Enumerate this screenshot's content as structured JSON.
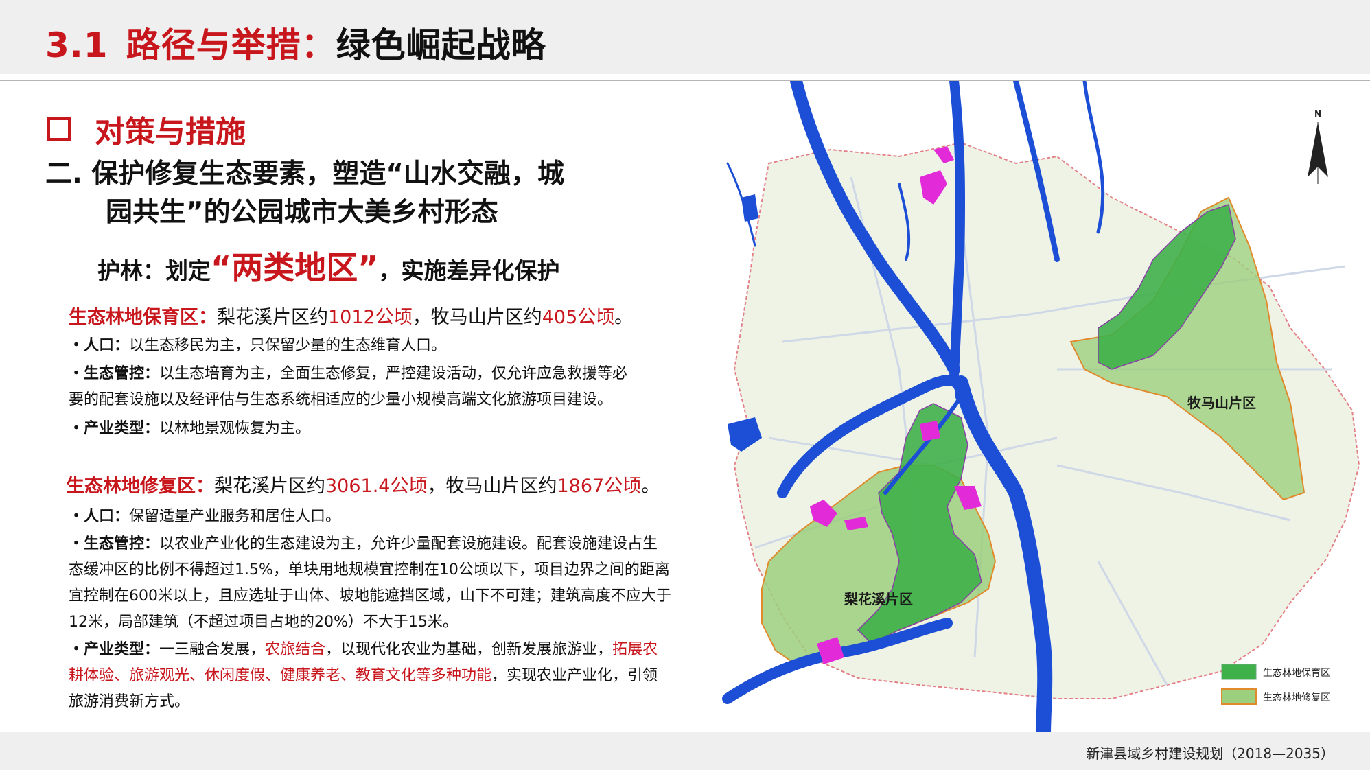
{
  "header": {
    "number": "3.1",
    "title_red": "路径与举措：",
    "title_black": "绿色崛起战略"
  },
  "section": {
    "heading": "对策与措施",
    "subheading_line1": "二.  保护修复生态要素，塑造“山水交融，城",
    "subheading_line2": "园共生”的公园城市大美乡村形态",
    "tagline_pre": "护林：划定",
    "tagline_highlight": "“两类地区”",
    "tagline_post": "，实施差异化保护"
  },
  "zone1": {
    "title": "生态林地保育区：",
    "t1": "梨花溪片区约",
    "v1": "1012公顷",
    "t2": "，牧马山片区约",
    "v2": "405公顷",
    "t3": "。",
    "pop_label": "・人口：",
    "pop_text": "以生态移民为主，只保留少量的生态维育人口。",
    "eco_label": "・生态管控：",
    "eco_text1": "以生态培育为主，全面生态修复，严控建设活动，仅允许应急救援等必",
    "eco_text2": "要的配套设施以及经评估与生态系统相适应的少量小规模高端文化旅游项目建设。",
    "ind_label": "・产业类型：",
    "ind_text": "以林地景观恢复为主。"
  },
  "zone2": {
    "title": "生态林地修复区：",
    "t1": "梨花溪片区约",
    "v1": "3061.4公顷",
    "t2": "，牧马山片区约",
    "v2": "1867公顷",
    "t3": "。",
    "pop_label": "・人口：",
    "pop_text": "保留适量产业服务和居住人口。",
    "eco_label": "・生态管控：",
    "eco_text1": "以农业产业化的生态建设为主，允许少量配套设施建设。配套设施建设占生",
    "eco_text2": "态缓冲区的比例不得超过1.5%，单块用地规模宜控制在10公顷以下，项目边界之间的距离",
    "eco_text3": "宜控制在600米以上，且应选址于山体、坡地能遮挡区域，山下不可建；建筑高度不应大于",
    "eco_text4": "12米，局部建筑（不超过项目占地的20%）不大于15米。",
    "ind_label": "・产业类型：",
    "ind_text1": "一三融合发展，",
    "ind_red1": "农旅结合",
    "ind_text2": "，以现代化农业为基础，创新发展旅游业，",
    "ind_red2": "拓展农",
    "ind_red3": "耕体验、旅游观光、休闲度假、健康养老、教育文化等多种功能",
    "ind_text3": "，实现农业产业化，引领",
    "ind_text4": "旅游消费新方式。"
  },
  "map": {
    "label_mumashan": "牧马山片区",
    "label_lihuaxi": "梨花溪片区",
    "north_label": "N",
    "legend_conserve": "生态林地保育区",
    "legend_restore": "生态林地修复区",
    "colors": {
      "river": "#1d4fd6",
      "conserve": "#3fb04a",
      "restore": "#9ccf7e",
      "restore_edge": "#e08a2c",
      "boundary": "#e37f86",
      "magenta": "#e22ad8"
    }
  },
  "footer": {
    "text": "新津县域乡村建设规划（2018—2035）"
  }
}
